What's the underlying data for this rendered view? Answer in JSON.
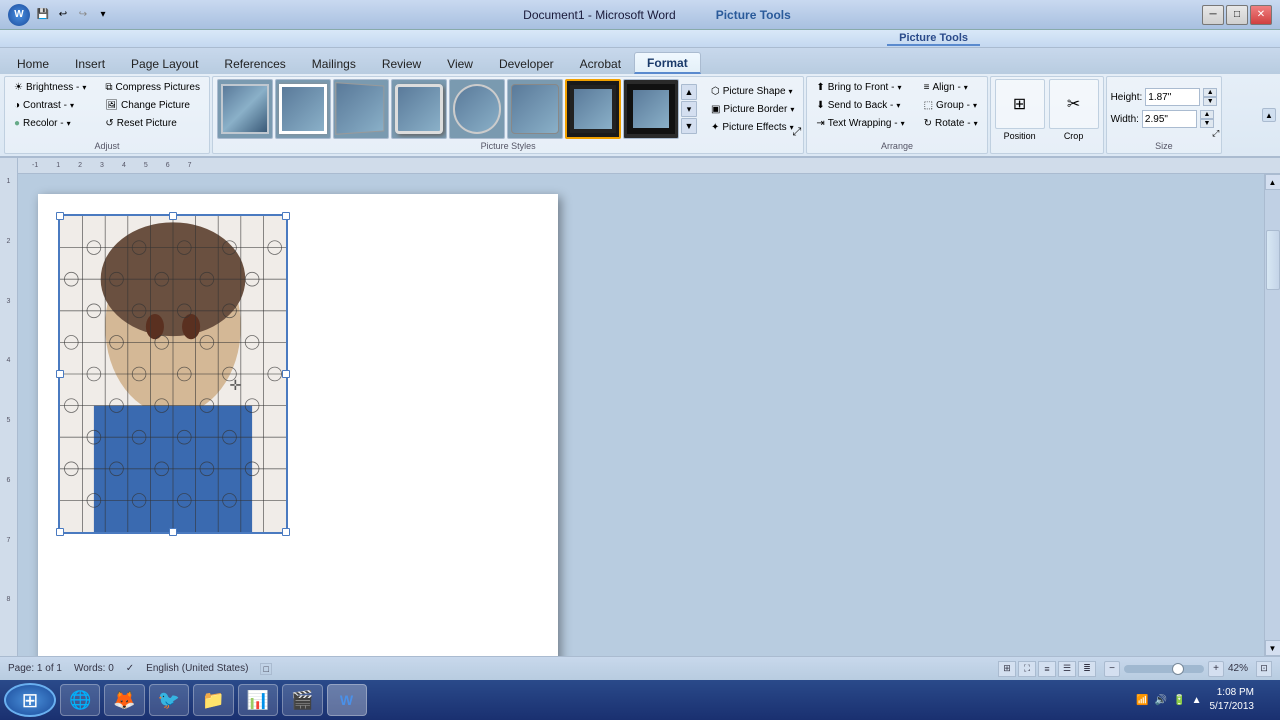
{
  "title_bar": {
    "document_name": "Document1 - Microsoft Word",
    "picture_tools": "Picture Tools",
    "quick_access": [
      "save",
      "undo",
      "redo"
    ],
    "window_buttons": [
      "minimize",
      "maximize",
      "close"
    ]
  },
  "ctx_label": "Picture Tools",
  "tabs": [
    {
      "id": "home",
      "label": "Home"
    },
    {
      "id": "insert",
      "label": "Insert"
    },
    {
      "id": "page_layout",
      "label": "Page Layout"
    },
    {
      "id": "references",
      "label": "References"
    },
    {
      "id": "mailings",
      "label": "Mailings"
    },
    {
      "id": "review",
      "label": "Review"
    },
    {
      "id": "view",
      "label": "View"
    },
    {
      "id": "developer",
      "label": "Developer"
    },
    {
      "id": "acrobat",
      "label": "Acrobat"
    },
    {
      "id": "format",
      "label": "Format",
      "active": true
    }
  ],
  "ribbon": {
    "groups": {
      "adjust": {
        "label": "Adjust",
        "buttons": [
          {
            "id": "brightness",
            "label": "Brightness -",
            "icon": "☀"
          },
          {
            "id": "contrast",
            "label": "Contrast -",
            "icon": "◑"
          },
          {
            "id": "recolor",
            "label": "Recolor -",
            "icon": "🎨"
          }
        ],
        "right_buttons": [
          {
            "id": "compress",
            "label": "Compress Pictures",
            "icon": "⧉"
          },
          {
            "id": "change_picture",
            "label": "Change Picture",
            "icon": "🖼"
          },
          {
            "id": "reset_picture",
            "label": "Reset Picture",
            "icon": "↺"
          }
        ]
      },
      "picture_styles": {
        "label": "Picture Styles",
        "thumbs": [
          "th1",
          "th2",
          "th3",
          "th4",
          "th5",
          "th6",
          "th7",
          "th8"
        ],
        "selected_index": 6,
        "side_buttons": [
          {
            "id": "picture_shape",
            "label": "Picture Shape",
            "icon": "⬡"
          },
          {
            "id": "picture_border",
            "label": "Picture Border",
            "icon": "▣"
          },
          {
            "id": "picture_effects",
            "label": "Picture Effects",
            "icon": "✦"
          }
        ]
      },
      "arrange": {
        "label": "Arrange",
        "buttons": [
          {
            "id": "bring_front",
            "label": "Bring to Front -",
            "icon": "⬆"
          },
          {
            "id": "align",
            "label": "Align -",
            "icon": "≡"
          },
          {
            "id": "send_back",
            "label": "Send to Back -",
            "icon": "⬇"
          },
          {
            "id": "group",
            "label": "Group -",
            "icon": "⬚"
          },
          {
            "id": "text_wrap",
            "label": "Text Wrapping -",
            "icon": "⇥"
          },
          {
            "id": "rotate",
            "label": "Rotate -",
            "icon": "↻"
          }
        ]
      },
      "position_crop": {
        "label": "",
        "position_label": "Position",
        "crop_label": "Crop"
      },
      "size": {
        "label": "Size",
        "height_label": "Height:",
        "height_value": "1.87\"",
        "width_label": "Width:",
        "width_value": "2.95\"",
        "expand_icon": "↗"
      }
    }
  },
  "document": {
    "page_label": "Page: 1 of 1",
    "words_label": "Words: 0",
    "language": "English (United States)",
    "zoom": "42%"
  },
  "taskbar": {
    "time": "1:08 PM",
    "date": "5/17/2013",
    "apps": [
      "⊞",
      "🌐",
      "🦊",
      "🐦",
      "📁",
      "📊",
      "🎬",
      "W"
    ]
  },
  "ruler": {
    "h_marks": [
      "-1",
      "1",
      "2",
      "3",
      "4",
      "5",
      "6",
      "7"
    ],
    "v_marks": [
      "1",
      "2",
      "3",
      "4",
      "5",
      "6",
      "7",
      "8"
    ]
  }
}
